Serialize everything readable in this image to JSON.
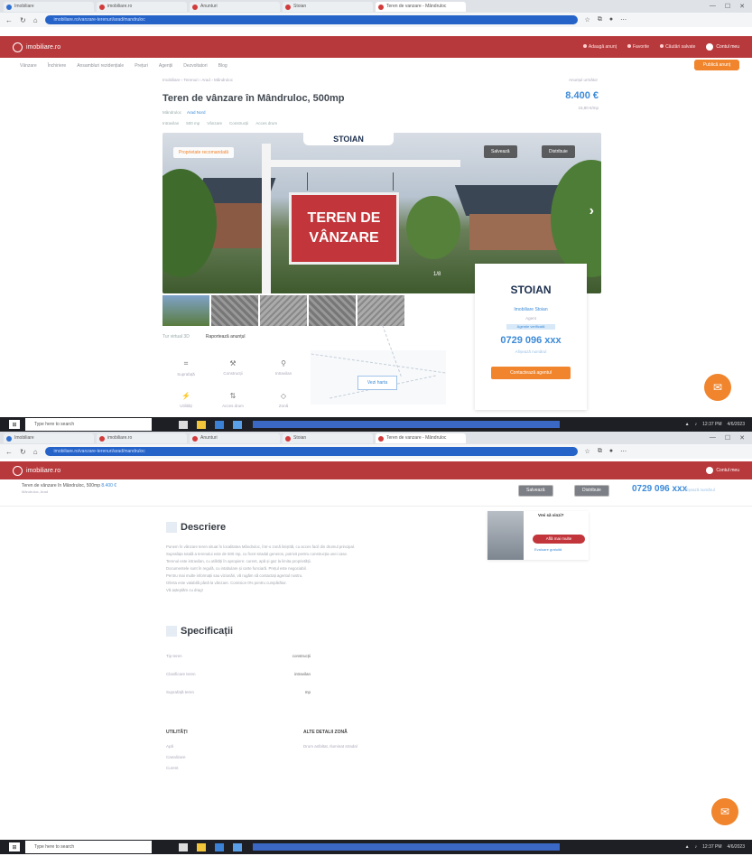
{
  "browser": {
    "tabs": [
      "Imobiliare",
      "imobiliare.ro",
      "Anunturi",
      "Stoian",
      "Teren de vanzare"
    ],
    "active_tab": "Teren de vanzare - Mândruloc",
    "url": "imobiliare.ro/vanzare-terenuri/arad/mandruloc"
  },
  "site": {
    "logo": "imobiliare.ro",
    "header_links": [
      "Adaugă anunț",
      "Favorite",
      "Căutări salvate"
    ],
    "account": "Contul meu",
    "subnav": [
      "Vânzare",
      "Închiriere",
      "Ansambluri rezidențiale",
      "Prețuri",
      "Agenții",
      "Dezvoltatori",
      "Blog"
    ],
    "post_button": "Publică anunț"
  },
  "listing": {
    "breadcrumb": "Imobiliare › Terenuri › Arad › Mândruloc",
    "breadcrumb_right": "Anunțul următor",
    "title": "Teren de vânzare în Mândruloc, 500mp",
    "price": "8.400 €",
    "price_sub": "16,80 €/mp",
    "location": "Mândruloc",
    "tag": "Arad Nord",
    "meta": [
      "Intravilan",
      "500 mp",
      "Vânzare",
      "Construcții",
      "Acces drum"
    ],
    "gallery": {
      "badge": "Proprietate recomandată",
      "btn_favorite": "Salvează",
      "btn_share": "Distribuie",
      "logo_text": "STOIAN",
      "sign_line1": "TEREN DE",
      "sign_line2": "VÂNZARE",
      "counter": "1/8"
    },
    "row_links": [
      "Tur virtual 3D",
      "Raportează anunțul"
    ],
    "features": [
      "Suprafață",
      "Construcții",
      "Intravilan",
      "Utilități",
      "Acces drum",
      "Zonă"
    ],
    "map_button": "Vezi harta"
  },
  "agent": {
    "logo": "STOIAN",
    "name": "Imobiliare Stoian",
    "role": "Agent",
    "chip": "Agenție verificată",
    "phone": "0729 096 xxx",
    "phone_sub": "Afișează numărul",
    "cta": "Contactează agentul"
  },
  "taskbar": {
    "search_placeholder": "Type here to search",
    "time": "12:37 PM",
    "date": "4/6/2023"
  },
  "page2": {
    "sticky_title": "Teren de vânzare în Mândruloc, 500mp",
    "sticky_tag": "8.400 €",
    "sticky_sub": "Mândruloc, Arad",
    "btn_save": "Salvează",
    "btn_share": "Distribuie",
    "phone": "0729 096 xxx",
    "phone_sub": "Afișează numărul",
    "promo_text": "Vrei să vinzi?",
    "promo_btn": "Află mai multe",
    "promo_sub": "Evaluare gratuită",
    "desc_heading": "Descriere",
    "description": [
      "Punem în vânzare teren situat în localitatea Mândruloc, într-o zonă liniștită, cu acces facil din drumul principal.",
      "Suprafața totală a terenului este de 500 mp, cu front stradal generos, potrivit pentru construcția unei case.",
      "Terenul este intravilan, cu utilități în apropiere: curent, apă și gaz la limita proprietății.",
      "Documentele sunt în regulă, cu intabulare și carte funciară. Prețul este negociabil.",
      "Pentru mai multe informații sau vizionări, vă rugăm să contactați agentul nostru.",
      "Oferta este valabilă până la vânzare. Comision 0% pentru cumpărător.",
      "Vă așteptăm cu drag!"
    ],
    "spec_heading": "Specificații",
    "specs": [
      {
        "label": "Tip teren",
        "value": "construcții"
      },
      {
        "label": "Clasificare teren",
        "value": "intravilan"
      },
      {
        "label": "Suprafață teren",
        "value": "mp"
      }
    ],
    "utilities_heading": "UTILITĂȚI",
    "utilities": [
      "Apă",
      "Canalizare",
      "Curent"
    ],
    "other_heading": "ALTE DETALII ZONĂ",
    "other": [
      "Drum asfaltat, Iluminat stradal"
    ]
  }
}
